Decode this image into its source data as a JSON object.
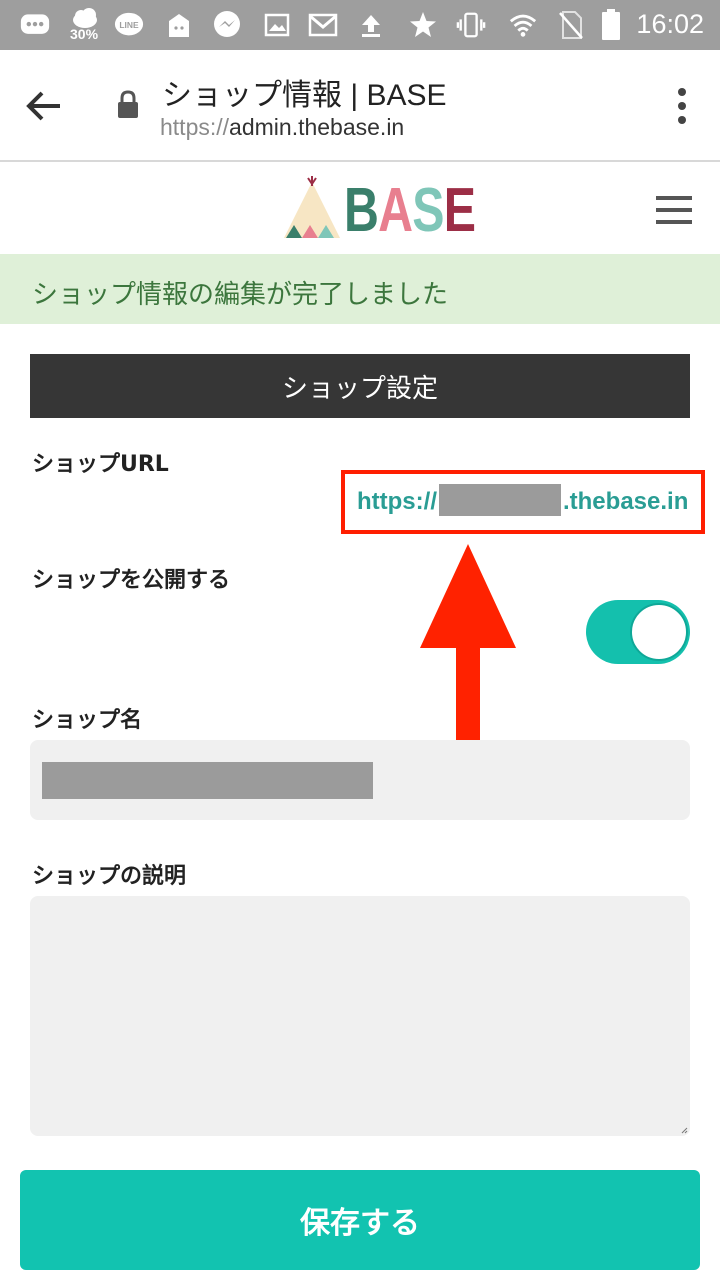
{
  "status_bar": {
    "time": "16:02",
    "weather_percent": "30%",
    "icons": [
      "message-icon",
      "weather-icon",
      "line-icon",
      "box-icon",
      "messenger-icon",
      "image-icon",
      "gmail-icon",
      "upload-icon",
      "star-icon",
      "vibrate-icon",
      "wifi-icon",
      "no-sim-icon",
      "battery-icon"
    ]
  },
  "browser": {
    "title": "ショップ情報 | BASE",
    "url_scheme": "https://",
    "url_host": "admin.thebase.in"
  },
  "site": {
    "logo_text": "BASE",
    "brand_colors": {
      "B": "#3a7f6b",
      "A": "#e87f8f",
      "S": "#7fc6b8",
      "E": "#9c2e46"
    }
  },
  "notice": {
    "text": "ショップ情報の編集が完了しました",
    "color": "#3c763d",
    "background": "#dff0d8"
  },
  "section": {
    "title": "ショップ設定"
  },
  "fields": {
    "shop_url_label": "ショップURL",
    "shop_url_prefix": "https://",
    "shop_url_suffix": ".thebase.in",
    "publish_label": "ショップを公開する",
    "publish_enabled": true,
    "shop_name_label": "ショップ名",
    "shop_description_label": "ショップの説明"
  },
  "save_button": {
    "label": "保存する",
    "color": "#12c3b0"
  },
  "annotation": {
    "highlight_color": "#ff1e00"
  }
}
